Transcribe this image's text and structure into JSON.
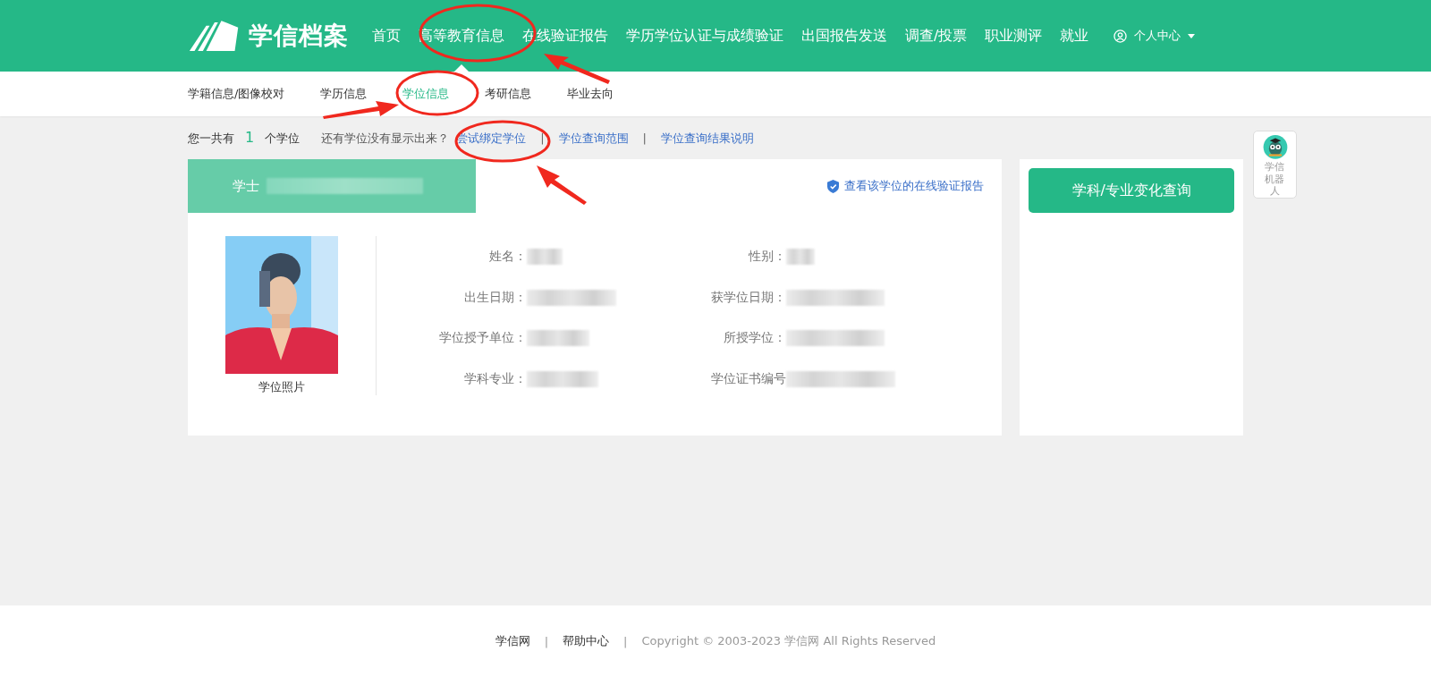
{
  "header": {
    "logo": "学信档案",
    "nav": [
      {
        "label": "首页",
        "selected": false
      },
      {
        "label": "高等教育信息",
        "selected": true
      },
      {
        "label": "在线验证报告",
        "selected": false
      },
      {
        "label": "学历学位认证与成绩验证",
        "selected": false
      },
      {
        "label": "出国报告发送",
        "selected": false
      },
      {
        "label": "调查/投票",
        "selected": false
      },
      {
        "label": "职业测评",
        "selected": false
      },
      {
        "label": "就业",
        "selected": false
      }
    ],
    "user_menu": "个人中心"
  },
  "subnav": [
    {
      "label": "学籍信息/图像校对",
      "selected": false
    },
    {
      "label": "学历信息",
      "selected": false
    },
    {
      "label": "学位信息",
      "selected": true
    },
    {
      "label": "考研信息",
      "selected": false
    },
    {
      "label": "毕业去向",
      "selected": false
    }
  ],
  "summary": {
    "prefix": "您一共有",
    "count": "1",
    "suffix": "个学位",
    "prompt": "还有学位没有显示出来？",
    "items": [
      {
        "kind": "link",
        "text": "尝试绑定学位"
      },
      {
        "kind": "separator",
        "text": "|"
      },
      {
        "kind": "link",
        "text": "学位查询范围"
      },
      {
        "kind": "separator",
        "text": "|"
      },
      {
        "kind": "link",
        "text": "学位查询结果说明"
      }
    ]
  },
  "degree_card": {
    "degree": "学士",
    "report_link": "查看该学位的在线验证报告",
    "photo_caption": "学位照片",
    "fields": [
      {
        "label": "姓名："
      },
      {
        "label": "性别："
      },
      {
        "label": "出生日期："
      },
      {
        "label": "获学位日期："
      },
      {
        "label": "学位授予单位："
      },
      {
        "label": "所授学位："
      },
      {
        "label": "学科专业："
      },
      {
        "label": "学位证书编号"
      }
    ]
  },
  "side_button": "学科/专业变化查询",
  "robot": "学信机器人",
  "footer": {
    "items": [
      {
        "kind": "link",
        "text": "学信网"
      },
      {
        "kind": "separator",
        "text": "|"
      },
      {
        "kind": "link",
        "text": "帮助中心"
      },
      {
        "kind": "separator",
        "text": "|"
      },
      {
        "kind": "text",
        "text": "Copyright © 2003-2023 学信网 All Rights Reserved"
      }
    ]
  }
}
